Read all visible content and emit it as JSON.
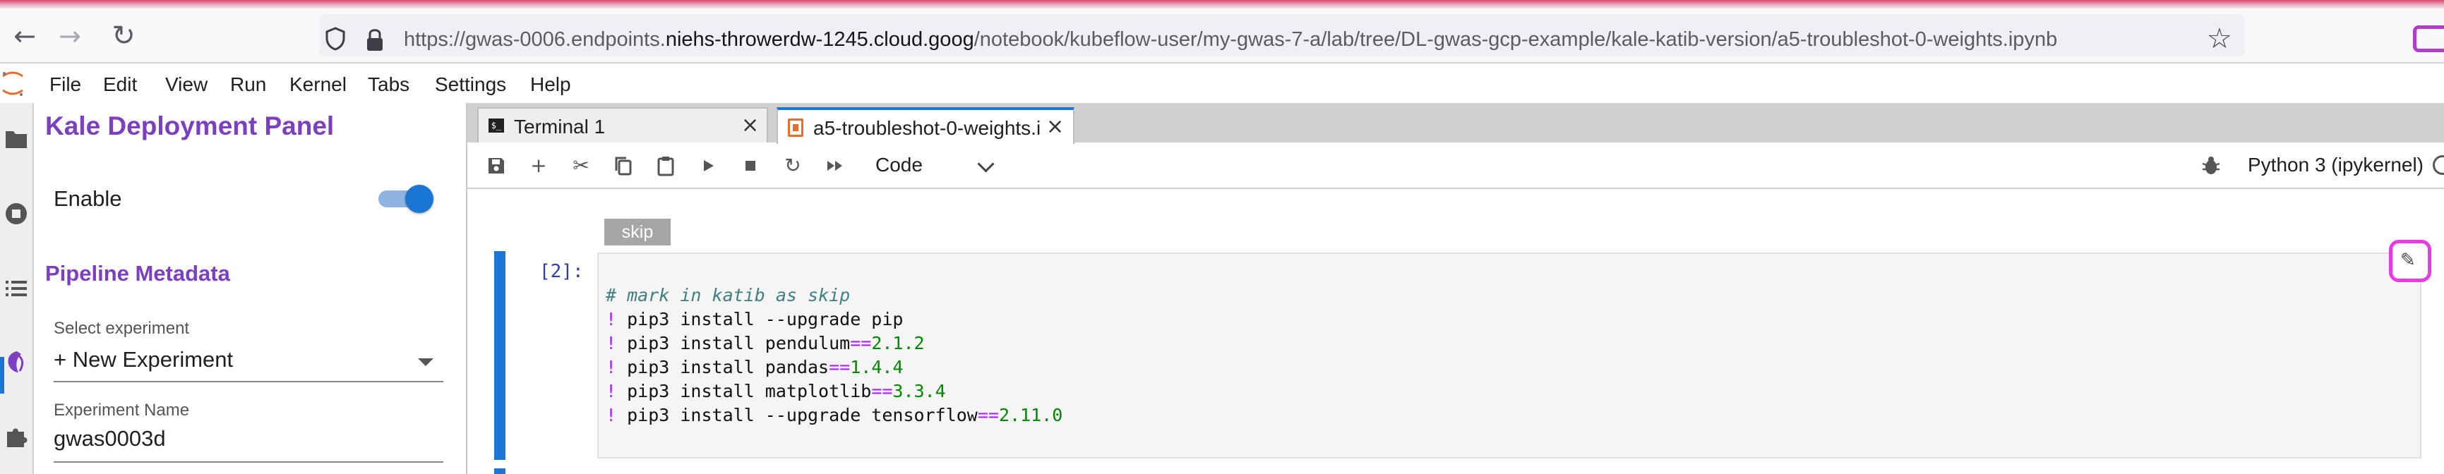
{
  "browser": {
    "url_prefix": "https://gwas-0006.endpoints.",
    "url_domain": "niehs-throwerdw-1245.cloud.goog",
    "url_path": "/notebook/kubeflow-user/my-gwas-7-a/lab/tree/DL-gwas-gcp-example/kale-katib-version/a5-troubleshot-0-weights.ipynb",
    "icons": [
      "back-icon",
      "forward-icon",
      "reload-icon",
      "shield-icon",
      "lock-icon",
      "bookmark-star-icon"
    ]
  },
  "menu": {
    "items": [
      "File",
      "Edit",
      "View",
      "Run",
      "Kernel",
      "Tabs",
      "Settings",
      "Help"
    ]
  },
  "sidebar": {
    "icons": [
      "folder-icon",
      "running-icon",
      "toc-icon",
      "kale-icon",
      "extension-icon"
    ]
  },
  "kale": {
    "title": "Kale Deployment Panel",
    "enable_label": "Enable",
    "enable_on": true,
    "metadata_title": "Pipeline Metadata",
    "select_experiment_label": "Select experiment",
    "select_experiment_value": "+ New Experiment",
    "experiment_name_label": "Experiment Name",
    "experiment_name_value": "gwas0003d"
  },
  "tabs": [
    {
      "label": "Terminal 1",
      "active": false
    },
    {
      "label": "a5-troubleshot-0-weights.i",
      "active": true
    }
  ],
  "notebook_toolbar": {
    "cell_type": "Code",
    "kernel": "Python 3 (ipykernel)",
    "icons": [
      "save-icon",
      "add-icon",
      "cut-icon",
      "copy-icon",
      "paste-icon",
      "run-icon",
      "stop-icon",
      "restart-icon",
      "run-all-icon",
      "debug-icon"
    ]
  },
  "cell": {
    "tag": "skip",
    "prompt": "[2]:",
    "code": {
      "comment": "# mark in katib as skip",
      "line1": "pip3 install --upgrade pip",
      "line2_a": "pip3 install pendulum",
      "line2_op": "==",
      "line2_num": "2.1.2",
      "line3_a": "pip3 install pandas",
      "line3_op": "==",
      "line3_num": "1.4.4",
      "line4_a": "pip3 install matplotlib",
      "line4_op": "==",
      "line4_num": "3.3.4",
      "line5_a": "pip3 install --upgrade tensorflow",
      "line5_op": "==",
      "line5_num": "2.11.0",
      "bang": "!"
    },
    "edit_icon": "pencil-icon"
  },
  "colors": {
    "kale_purple": "#7b3fc0",
    "accent_blue": "#1976d2",
    "highlight_pink": "#ea3ae6"
  }
}
